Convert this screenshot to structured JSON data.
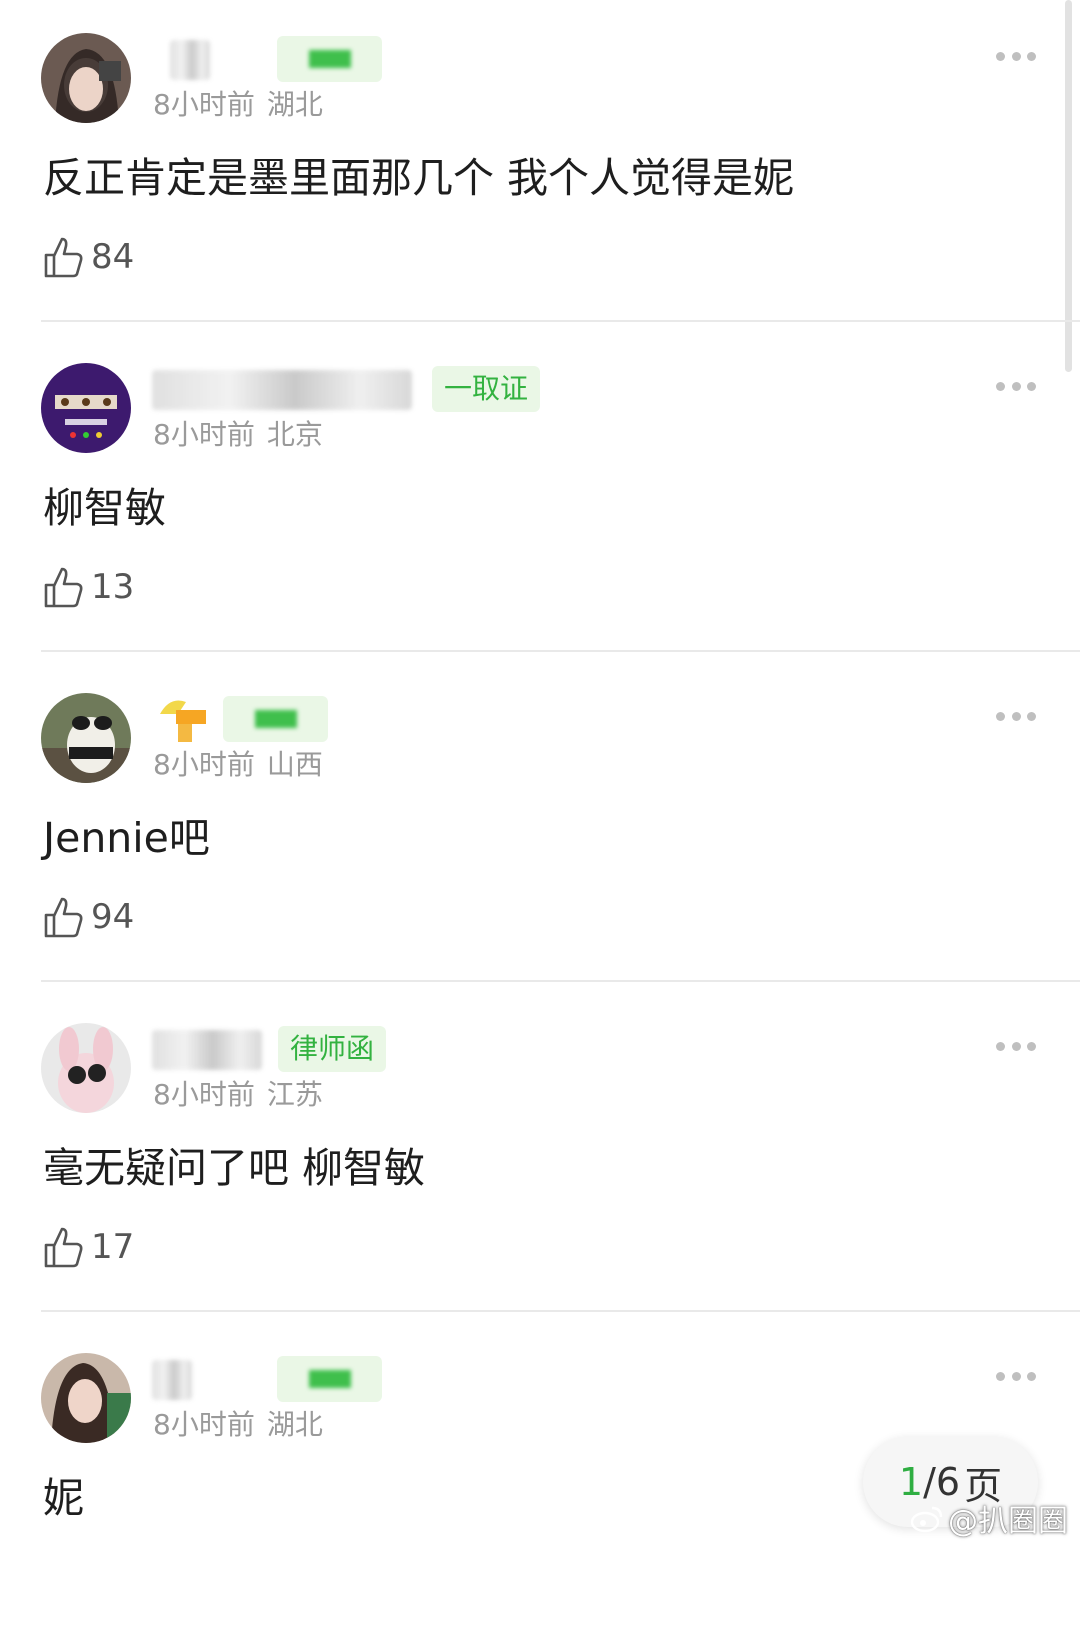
{
  "comments": [
    {
      "time": "8小时前",
      "location": "湖北",
      "content": "反正肯定是墨里面那几个 我个人觉得是妮",
      "likes": "84",
      "badge": ""
    },
    {
      "time": "8小时前",
      "location": "北京",
      "content": "柳智敏",
      "likes": "13",
      "badge": "一取证"
    },
    {
      "time": "8小时前",
      "location": "山西",
      "content": "Jennie吧",
      "likes": "94",
      "badge": ""
    },
    {
      "time": "8小时前",
      "location": "江苏",
      "content": "毫无疑问了吧 柳智敏",
      "likes": "17",
      "badge": "律师函"
    },
    {
      "time": "8小时前",
      "location": "湖北",
      "content": "妮",
      "likes": "",
      "badge": ""
    }
  ],
  "pager": {
    "current": "1",
    "total": "/6",
    "suffix": "页"
  },
  "watermark": {
    "text": "@扒圈圈"
  },
  "colors": {
    "accent_green": "#33b240",
    "meta_gray": "#9a9a9a"
  },
  "icons": {
    "like": "thumbs-up-icon",
    "more": "more-dots-icon",
    "watermark": "weibo-logo-icon"
  }
}
